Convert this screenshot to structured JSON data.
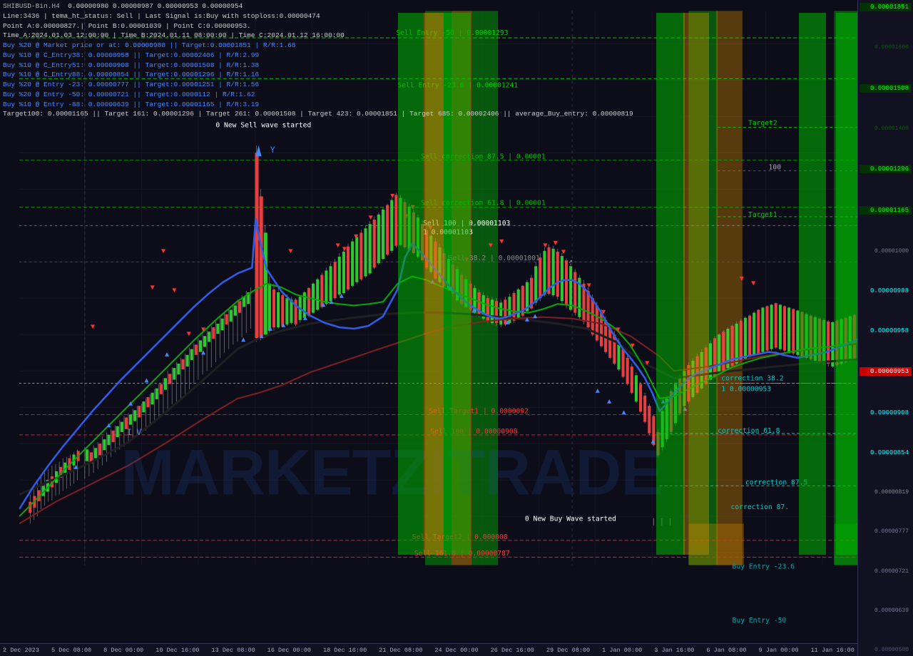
{
  "title": "SHIBUSD-Bin.H4",
  "ticker_info": {
    "symbol": "SHIBUSD-Bin.H4",
    "values": "0.00000980 0.00000987 0.00000953 0.00000954",
    "line": "Line:3436 | tema_ht_status: Sell | Last Signal is:Buy with stoploss:0.00000474",
    "points": "Point A:0.00000827.| Point B:0.00001039 | Point C:0.00000953.",
    "times": "Time A:2024.01.03 12:00:00 | Time B:2024.01.11 08:00:00 | Time C:2024.01.12 16:00:00",
    "buy20_market": "Buy %20 @ Market price or at: 0.00000988 || Target:0.00001851 | R/R:1.68",
    "buy10_centry38": "Buy %10 @ C_Entry38: 0.00000958 || Target:0.00002406 | R/R:2.99",
    "buy10_centry51": "Buy %10 @ C_Entry51: 0.00000908 || Target:0.00001508 | R/R:1.38",
    "buy10_centry88": "Buy %10 @ C_Entry88: 0.00000854 || Target:0.00001296 | R/R:1.16",
    "buy20_entry_neg23": "Buy %20 @ Entry -23: 0.00000777 || Target:0.00001251 | R/R:1.56",
    "buy20_entry_neg50": "Buy %20 @ Entry -50: 0.00000721 || Target:0.0000112 | R/R:1.62",
    "buy10_entry_neg88": "Buy %10 @ Entry -88: 0.00000639 || Target:0.00001165 | R/R:3.19",
    "targets": "Target100: 0.00001165 || Target 161: 0.00001296 | Target 261: 0.00001508 | Target 423: 0.00001851 | Target 685: 0.00002406 || average_Buy_entry: 0.00000819"
  },
  "chart_labels": {
    "new_sell_wave": "0 New Sell wave started",
    "new_buy_wave": "0 New Buy Wave started",
    "sell_entry_neg50": "Sell Entry -50 | 0.00001293",
    "sell_entry_neg23_6": "Sell Entry -23.6 | 0.00001241",
    "sell_correction_87_5": "Sell correction 87.5 | 0.00001",
    "sell_correction_61_8": "Sell correction 61.8 | 0.00001",
    "sell_100": "Sell 100 | 0.00001103",
    "sell_38_2": "Sell 38.2 | 0.00001001",
    "sell_target1": "Sell Target1 | 0.0000092",
    "sell_100_2": "Sell 100 | 0.00000908",
    "sell_target2": "Sell Target2 | 0.000008",
    "sell_161_8": "Sell 161.8 | 0.00000787",
    "correction_38_2": "correction 38.2",
    "price_38_2": "1 0.00000953",
    "correction_61_8": "correction 61.8",
    "correction_87_5": "correction 87.5",
    "correction_87_special": "correction 87.",
    "buy_entry_neg23_6": "Buy Entry -23.6",
    "buy_entry_neg50": "Buy Entry -50",
    "target1": "Target1",
    "target2": "Target2",
    "label_100": "100",
    "label_iv": "IV"
  },
  "price_scale": {
    "prices": [
      {
        "value": "0.00001851",
        "type": "green"
      },
      {
        "value": "0.00001508",
        "type": "green"
      },
      {
        "value": "0.00001296",
        "type": "green"
      },
      {
        "value": "0.00001165",
        "type": "green"
      },
      {
        "value": "0.00000988",
        "type": "cyan"
      },
      {
        "value": "0.00000958",
        "type": "cyan"
      },
      {
        "value": "0.00000908",
        "type": "cyan"
      },
      {
        "value": "0.00000854",
        "type": "cyan"
      },
      {
        "value": "0.00000819",
        "type": "normal"
      },
      {
        "value": "0.00000777",
        "type": "normal"
      },
      {
        "value": "0.00000721",
        "type": "normal"
      },
      {
        "value": "0.00000639",
        "type": "normal"
      }
    ]
  },
  "time_labels": [
    "2 Dec 2023",
    "5 Dec 08:00",
    "8 Dec 00:00",
    "10 Dec 16:00",
    "13 Dec 08:00",
    "16 Dec 00:00",
    "18 Dec 16:00",
    "21 Dec 08:00",
    "24 Dec 00:00",
    "26 Dec 16:00",
    "29 Dec 08:00",
    "1 Jan 00:00",
    "3 Jan 16:00",
    "6 Jan 08:00",
    "9 Jan 00:00",
    "11 Jan 16:00"
  ],
  "watermark": "MARKETZITRADE",
  "colors": {
    "background": "#0d0d1a",
    "grid": "#1a1a33",
    "green_zone": "rgba(0,180,0,0.55)",
    "orange_zone": "rgba(210,140,0,0.55)",
    "sell_line": "#ff3333",
    "buy_line": "#00cc00",
    "ema_blue": "#2244ff",
    "ema_green": "#00bb00",
    "ema_black": "#111111",
    "ema_darkred": "#880000"
  }
}
